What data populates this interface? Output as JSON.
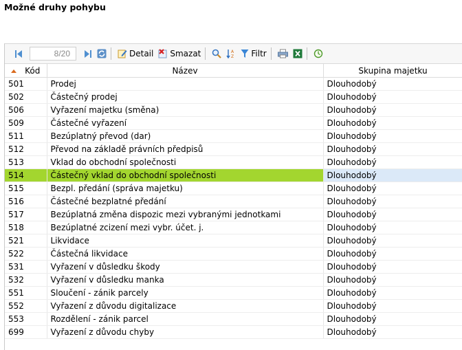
{
  "page": {
    "title": "Možné druhy pohybu"
  },
  "toolbar": {
    "pager_value": "8/20",
    "detail_label": "Detail",
    "delete_label": "Smazat",
    "filter_label": "Filtr"
  },
  "table": {
    "columns": {
      "code": "Kód",
      "name": "Název",
      "group": "Skupina majetku"
    },
    "rows": [
      {
        "code": "501",
        "name": "Prodej",
        "group": "Dlouhodobý"
      },
      {
        "code": "502",
        "name": "Částečný prodej",
        "group": "Dlouhodobý"
      },
      {
        "code": "506",
        "name": "Vyřazení majetku (směna)",
        "group": "Dlouhodobý"
      },
      {
        "code": "509",
        "name": "Částečné vyřazení",
        "group": "Dlouhodobý"
      },
      {
        "code": "511",
        "name": "Bezúplatný převod (dar)",
        "group": "Dlouhodobý"
      },
      {
        "code": "512",
        "name": "Převod na základě právních předpisů",
        "group": "Dlouhodobý"
      },
      {
        "code": "513",
        "name": "Vklad do obchodní společnosti",
        "group": "Dlouhodobý"
      },
      {
        "code": "514",
        "name": "Částečný vklad do obchodní společnosti",
        "group": "Dlouhodobý"
      },
      {
        "code": "515",
        "name": "Bezpl. předání (správa majetku)",
        "group": "Dlouhodobý"
      },
      {
        "code": "516",
        "name": "Částečné bezplatné předání",
        "group": "Dlouhodobý"
      },
      {
        "code": "517",
        "name": "Bezúplatná změna dispozic mezi vybranými jednotkami",
        "group": "Dlouhodobý"
      },
      {
        "code": "518",
        "name": "Bezúplatné zcizení mezi vybr. účet. j.",
        "group": "Dlouhodobý"
      },
      {
        "code": "521",
        "name": "Likvidace",
        "group": "Dlouhodobý"
      },
      {
        "code": "522",
        "name": "Částečná likvidace",
        "group": "Dlouhodobý"
      },
      {
        "code": "531",
        "name": "Vyřazení v důsledku škody",
        "group": "Dlouhodobý"
      },
      {
        "code": "532",
        "name": "Vyřazení v důsledku manka",
        "group": "Dlouhodobý"
      },
      {
        "code": "551",
        "name": "Sloučení - zánik parcely",
        "group": "Dlouhodobý"
      },
      {
        "code": "552",
        "name": "Vyřazení z důvodu digitalizace",
        "group": "Dlouhodobý"
      },
      {
        "code": "553",
        "name": "Rozdělení - zánik parcel",
        "group": "Dlouhodobý"
      },
      {
        "code": "699",
        "name": "Vyřazení z důvodu chyby",
        "group": "Dlouhodobý"
      }
    ],
    "selected_index": 7
  },
  "colors": {
    "selected_row": "#a3d62f",
    "selected_group_cell": "#dbe9f8",
    "sort_arrow": "#d96a1e"
  },
  "icons": [
    "first-page-icon",
    "last-page-icon",
    "refresh-icon",
    "detail-icon",
    "delete-icon",
    "search-icon",
    "sort-icon",
    "filter-icon",
    "print-icon",
    "excel-icon",
    "history-icon"
  ]
}
